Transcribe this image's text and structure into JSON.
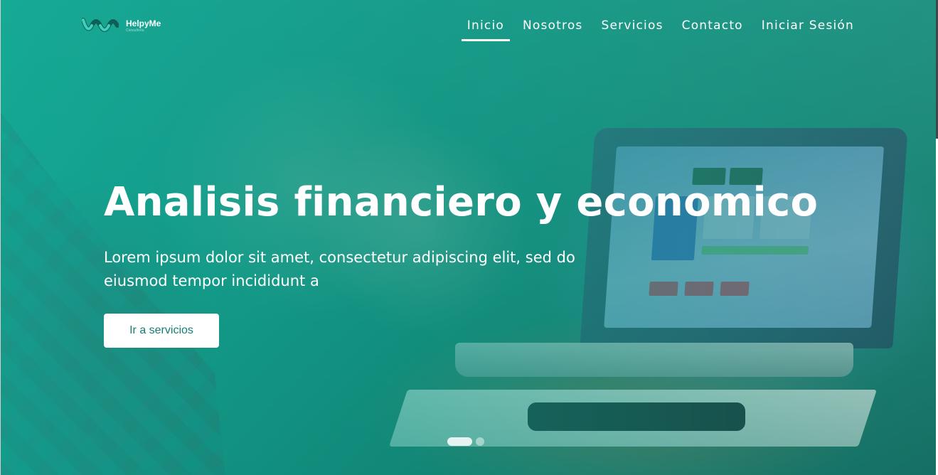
{
  "brand": {
    "name": "HelpyMe",
    "tagline": "Consultoría",
    "logo_icon": "helpyme-logo-icon",
    "colors": {
      "mark_dark": "#0f5e57",
      "mark_light": "#3fd1b8"
    }
  },
  "nav": {
    "items": [
      {
        "label": "Inicio",
        "active": true
      },
      {
        "label": "Nosotros",
        "active": false
      },
      {
        "label": "Servicios",
        "active": false
      },
      {
        "label": "Contacto",
        "active": false
      },
      {
        "label": "Iniciar Sesión",
        "active": false
      }
    ]
  },
  "hero": {
    "title": "Analisis financiero y economico",
    "text": "Lorem ipsum dolor sit amet, consectetur adipiscing elit, sed do eiusmod tempor incididunt a",
    "cta_label": "Ir a servicios",
    "cta_text_color": "#127f73",
    "overlay_color": "#10aa96"
  },
  "carousel": {
    "slides": 2,
    "active_index": 0
  }
}
